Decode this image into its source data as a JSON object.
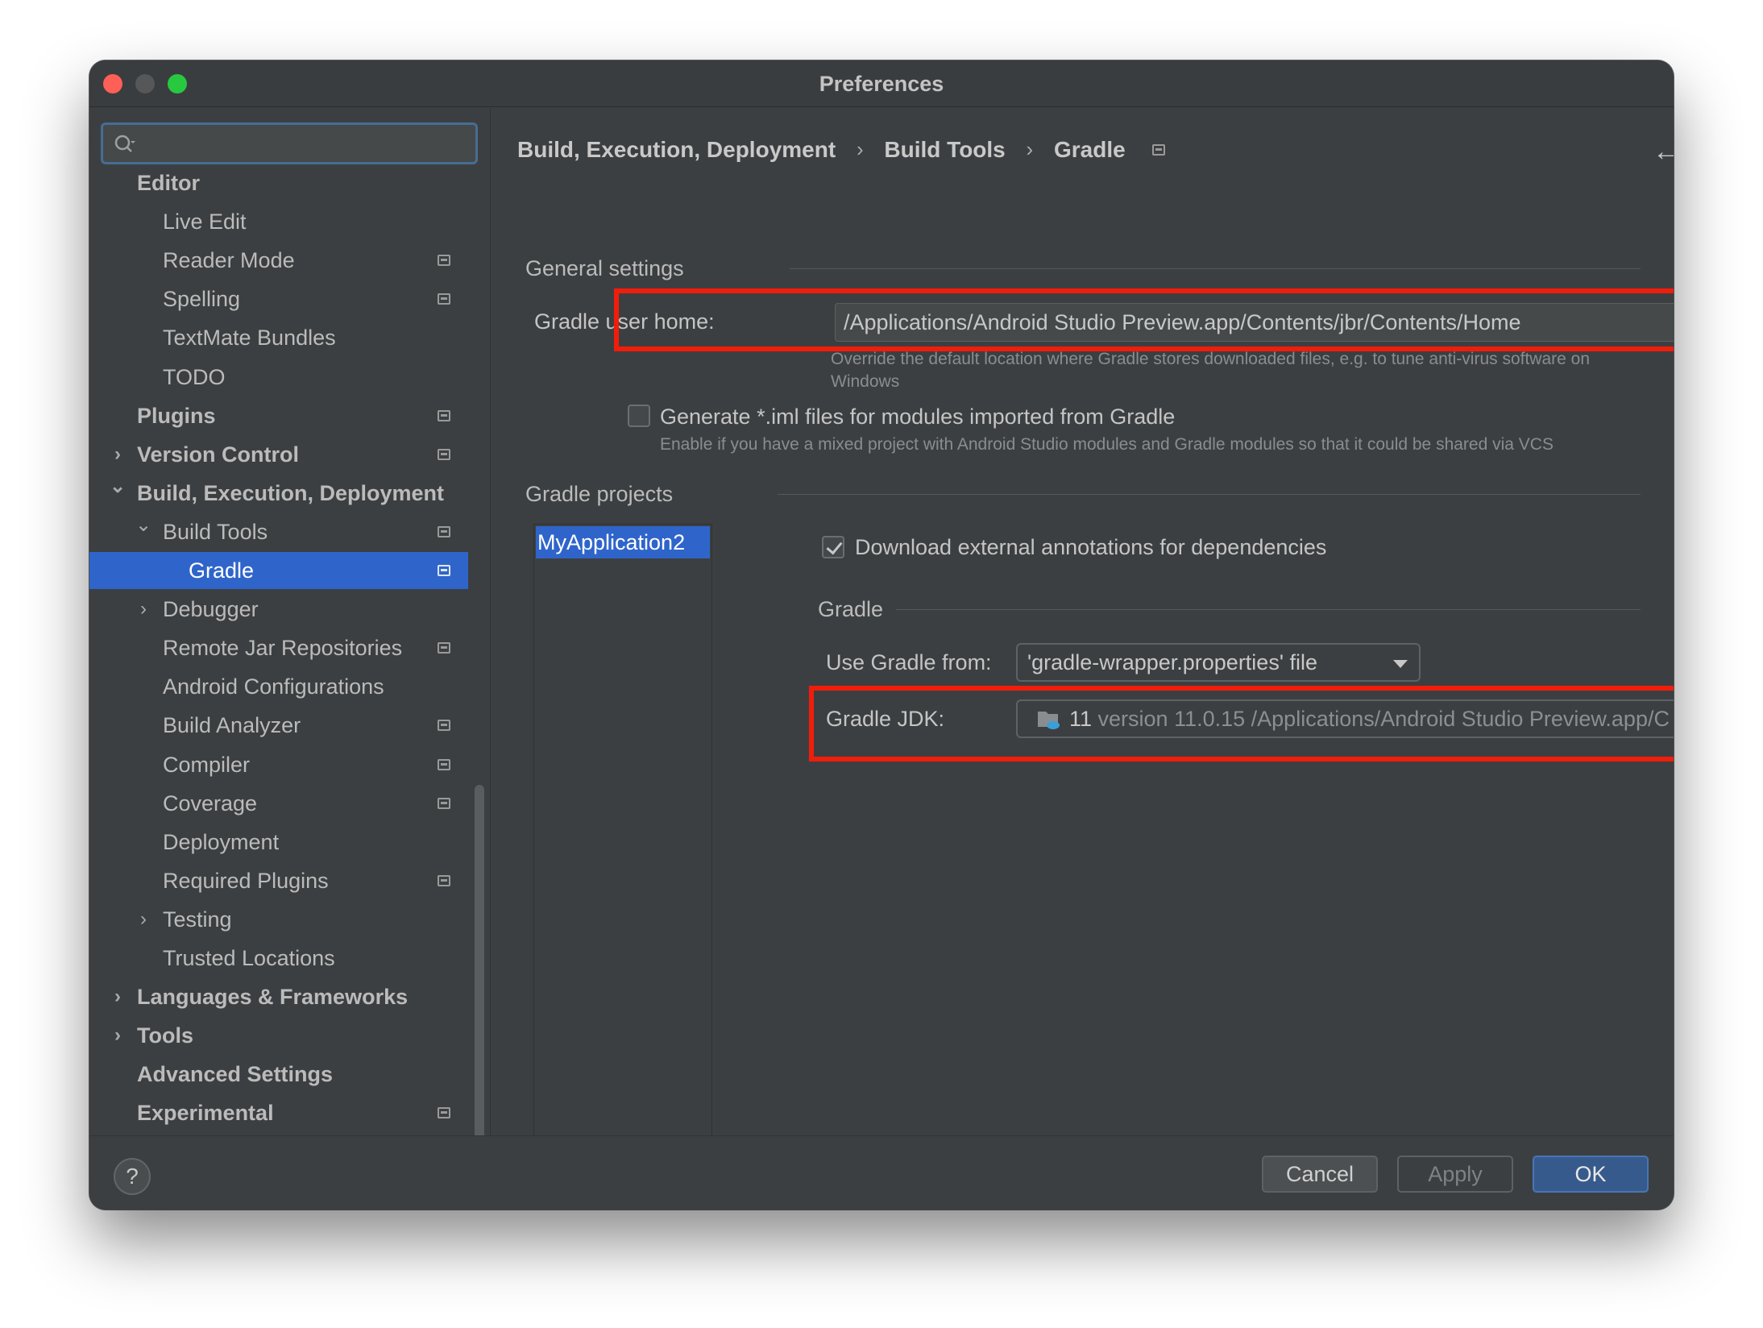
{
  "window": {
    "title": "Preferences"
  },
  "search": {
    "placeholder": ""
  },
  "sidebar": {
    "items": [
      {
        "label": "Editor",
        "bold": true,
        "level": 0,
        "chevron": "",
        "project": false,
        "selected": false
      },
      {
        "label": "Live Edit",
        "bold": false,
        "level": 1,
        "chevron": "",
        "project": false,
        "selected": false
      },
      {
        "label": "Reader Mode",
        "bold": false,
        "level": 1,
        "chevron": "",
        "project": true,
        "selected": false
      },
      {
        "label": "Spelling",
        "bold": false,
        "level": 1,
        "chevron": "",
        "project": true,
        "selected": false
      },
      {
        "label": "TextMate Bundles",
        "bold": false,
        "level": 1,
        "chevron": "",
        "project": false,
        "selected": false
      },
      {
        "label": "TODO",
        "bold": false,
        "level": 1,
        "chevron": "",
        "project": false,
        "selected": false
      },
      {
        "label": "Plugins",
        "bold": true,
        "level": 0,
        "chevron": "",
        "project": true,
        "selected": false
      },
      {
        "label": "Version Control",
        "bold": true,
        "level": 0,
        "chevron": "right",
        "project": true,
        "selected": false
      },
      {
        "label": "Build, Execution, Deployment",
        "bold": true,
        "level": 0,
        "chevron": "down",
        "project": false,
        "selected": false
      },
      {
        "label": "Build Tools",
        "bold": false,
        "level": 1,
        "chevron": "down",
        "project": true,
        "selected": false
      },
      {
        "label": "Gradle",
        "bold": false,
        "level": 2,
        "chevron": "",
        "project": true,
        "selected": true
      },
      {
        "label": "Debugger",
        "bold": false,
        "level": 1,
        "chevron": "right",
        "project": false,
        "selected": false
      },
      {
        "label": "Remote Jar Repositories",
        "bold": false,
        "level": 1,
        "chevron": "",
        "project": true,
        "selected": false
      },
      {
        "label": "Android Configurations",
        "bold": false,
        "level": 1,
        "chevron": "",
        "project": false,
        "selected": false
      },
      {
        "label": "Build Analyzer",
        "bold": false,
        "level": 1,
        "chevron": "",
        "project": true,
        "selected": false
      },
      {
        "label": "Compiler",
        "bold": false,
        "level": 1,
        "chevron": "",
        "project": true,
        "selected": false
      },
      {
        "label": "Coverage",
        "bold": false,
        "level": 1,
        "chevron": "",
        "project": true,
        "selected": false
      },
      {
        "label": "Deployment",
        "bold": false,
        "level": 1,
        "chevron": "",
        "project": false,
        "selected": false
      },
      {
        "label": "Required Plugins",
        "bold": false,
        "level": 1,
        "chevron": "",
        "project": true,
        "selected": false
      },
      {
        "label": "Testing",
        "bold": false,
        "level": 1,
        "chevron": "right",
        "project": false,
        "selected": false
      },
      {
        "label": "Trusted Locations",
        "bold": false,
        "level": 1,
        "chevron": "",
        "project": false,
        "selected": false
      },
      {
        "label": "Languages & Frameworks",
        "bold": true,
        "level": 0,
        "chevron": "right",
        "project": false,
        "selected": false
      },
      {
        "label": "Tools",
        "bold": true,
        "level": 0,
        "chevron": "right",
        "project": false,
        "selected": false
      },
      {
        "label": "Advanced Settings",
        "bold": true,
        "level": 0,
        "chevron": "",
        "project": false,
        "selected": false
      },
      {
        "label": "Experimental",
        "bold": true,
        "level": 0,
        "chevron": "",
        "project": true,
        "selected": false
      }
    ]
  },
  "breadcrumb": {
    "items": [
      "Build, Execution, Deployment",
      "Build Tools",
      "Gradle"
    ],
    "separator": "›"
  },
  "nav": {
    "back": "←",
    "forward": "→"
  },
  "general": {
    "title": "General settings",
    "gradle_home_label": "Gradle user home:",
    "gradle_home_value": "/Applications/Android Studio Preview.app/Contents/jbr/Contents/Home",
    "gradle_home_hint_1": "Override the default location where Gradle stores downloaded files, e.g. to tune anti-virus software on",
    "gradle_home_hint_2": "Windows",
    "iml_label": "Generate *.iml files for modules imported from Gradle",
    "iml_checked": false,
    "iml_hint": "Enable if you have a mixed project with Android Studio modules and Gradle modules so that it could be shared via VCS"
  },
  "projects": {
    "title": "Gradle projects",
    "list": [
      "MyApplication2"
    ],
    "download_annotations_label": "Download external annotations for dependencies",
    "download_annotations_checked": true,
    "gradle_title": "Gradle",
    "use_gradle_from_label": "Use Gradle from:",
    "use_gradle_from_value": "'gradle-wrapper.properties' file",
    "jdk_label": "Gradle JDK:",
    "jdk_value_main": "11",
    "jdk_value_detail": " version 11.0.15 /Applications/Android Studio Preview.app/C"
  },
  "buttons": {
    "help": "?",
    "cancel": "Cancel",
    "apply": "Apply",
    "ok": "OK"
  },
  "colors": {
    "accent": "#2f65ca",
    "highlight": "#f11d0b",
    "background": "#3c3f41"
  }
}
